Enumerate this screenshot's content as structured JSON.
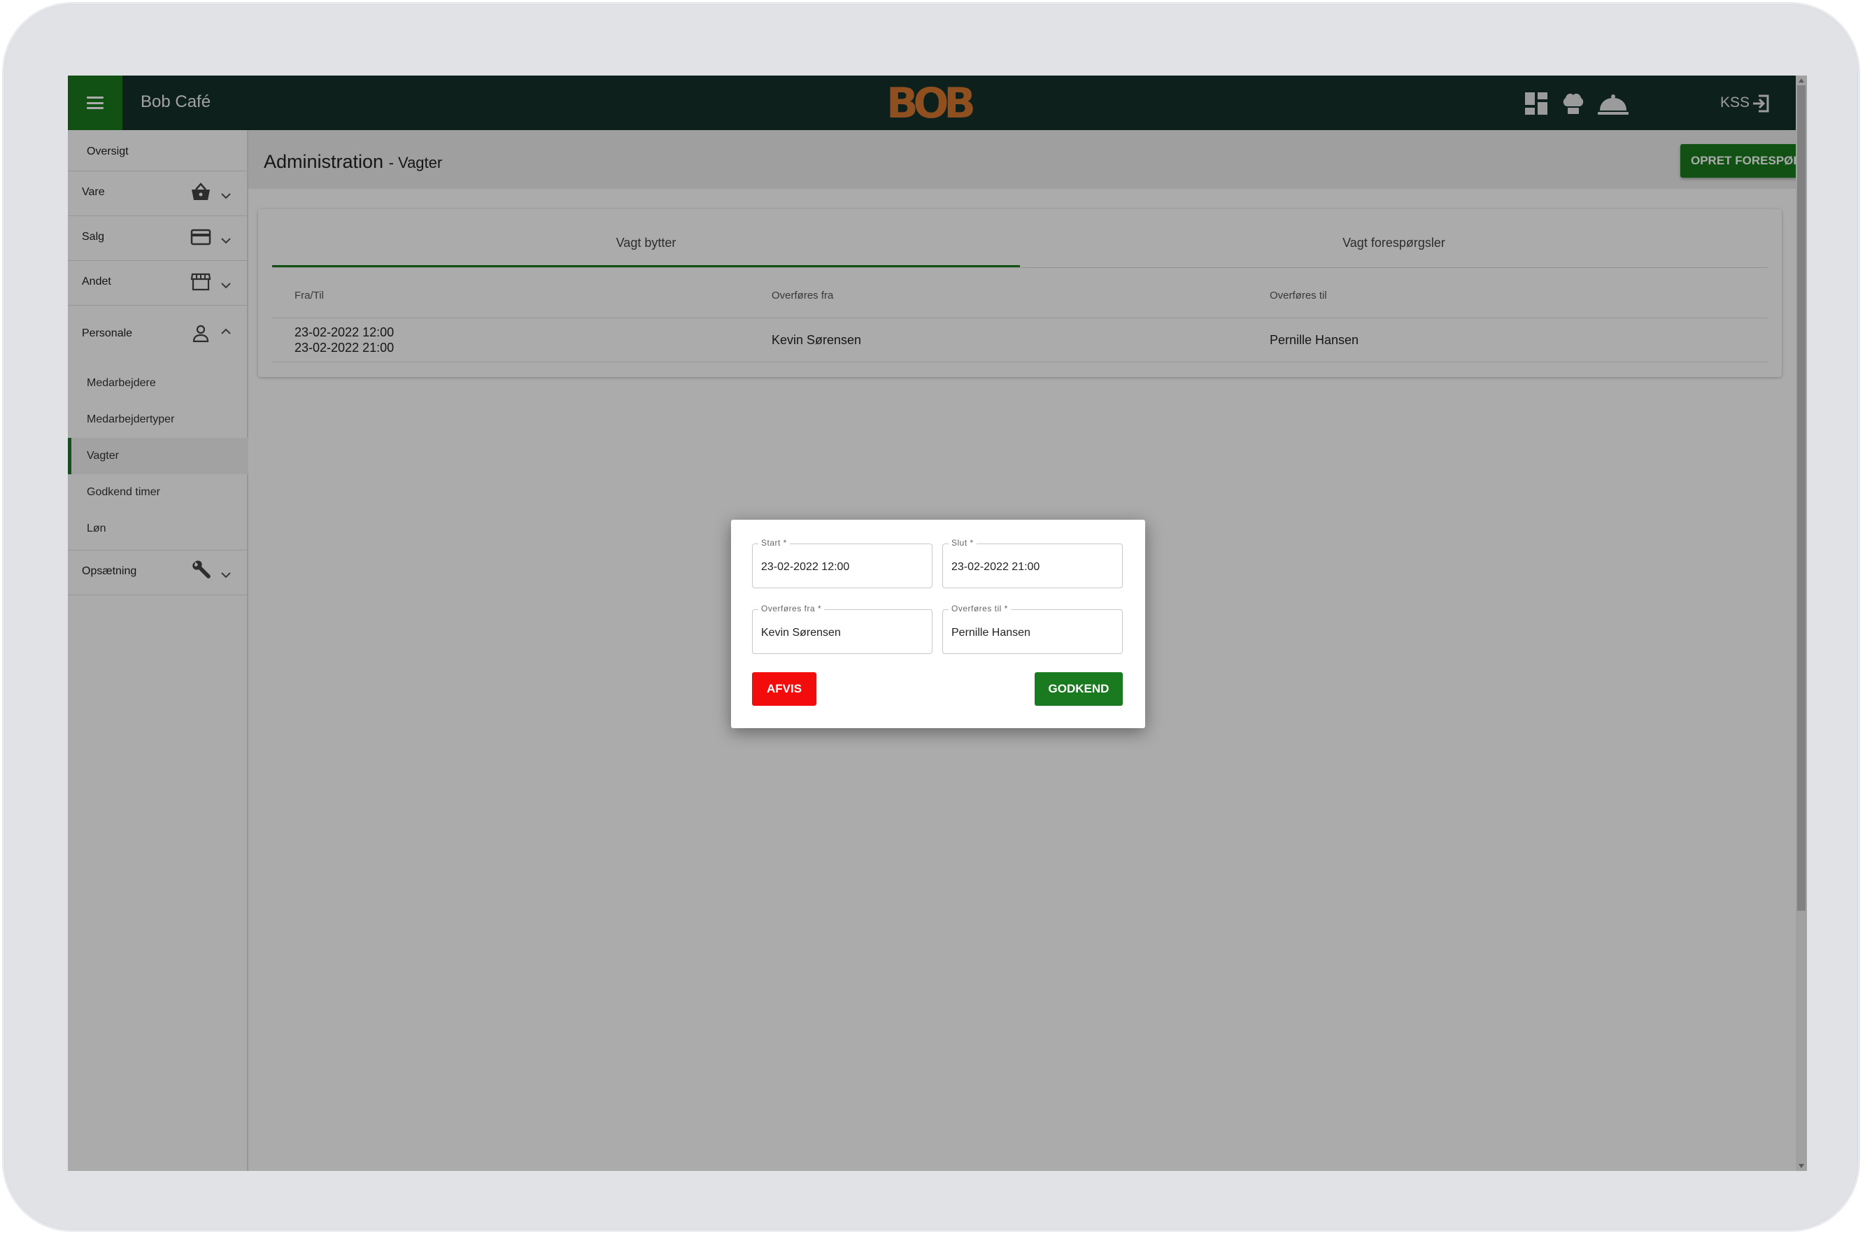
{
  "header": {
    "app_title": "Bob Café",
    "logo_text": "BOB",
    "user": "KSS",
    "icons": [
      "dashboard-icon",
      "chef-hat-icon",
      "cloche-icon",
      "logout-icon"
    ]
  },
  "sidebar": {
    "overview": "Oversigt",
    "sections": [
      {
        "label": "Vare",
        "icon": "basket-icon"
      },
      {
        "label": "Salg",
        "icon": "credit-card-icon"
      },
      {
        "label": "Andet",
        "icon": "store-icon"
      },
      {
        "label": "Personale",
        "icon": "person-icon",
        "expanded": true
      },
      {
        "label": "Opsætning",
        "icon": "wrench-icon"
      }
    ],
    "sub_items": [
      "Medarbejdere",
      "Medarbejdertyper",
      "Vagter",
      "Godkend timer",
      "Løn"
    ],
    "active_sub": "Vagter"
  },
  "page": {
    "title": "Administration",
    "subtitle": "- Vagter",
    "create_button": "OPRET FORESPØRGSEL"
  },
  "tabs": [
    {
      "label": "Vagt bytter",
      "active": true
    },
    {
      "label": "Vagt forespørgsler",
      "active": false
    }
  ],
  "table": {
    "columns": [
      "Fra/Til",
      "Overføres fra",
      "Overføres til"
    ],
    "rows": [
      {
        "from_time": "23-02-2022 12:00",
        "to_time": "23-02-2022 21:00",
        "from_person": "Kevin Sørensen",
        "to_person": "Pernille Hansen"
      }
    ]
  },
  "dialog": {
    "start_label": "Start *",
    "start_value": "23-02-2022 12:00",
    "end_label": "Slut *",
    "end_value": "23-02-2022 21:00",
    "from_label": "Overføres fra *",
    "from_value": "Kevin Sørensen",
    "to_label": "Overføres til *",
    "to_value": "Pernille Hansen",
    "reject_button": "AFVIS",
    "approve_button": "GODKEND"
  },
  "colors": {
    "topbar": "#16302b",
    "accent_green": "#1a7a1f",
    "reject_red": "#f20c0c",
    "logo_orange": "#d6762e"
  }
}
